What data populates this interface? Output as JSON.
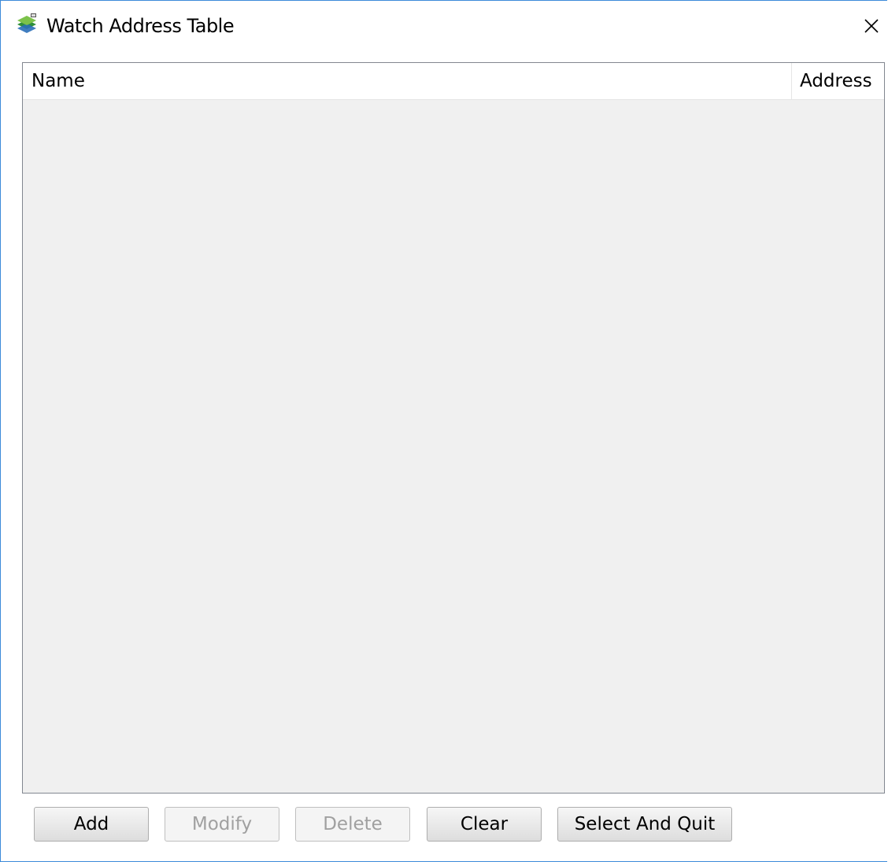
{
  "window": {
    "title": "Watch Address Table",
    "app_icon": "app-stack-icon",
    "close_icon": "close-icon"
  },
  "table": {
    "columns": [
      "Name",
      "Address"
    ],
    "rows": []
  },
  "buttons": {
    "add": "Add",
    "modify": "Modify",
    "delete": "Delete",
    "clear": "Clear",
    "select_and_quit": "Select And Quit"
  },
  "colors": {
    "accent_border": "#3c8ad9",
    "table_background": "#f0f0f0",
    "disabled_text": "#a0a0a0"
  }
}
